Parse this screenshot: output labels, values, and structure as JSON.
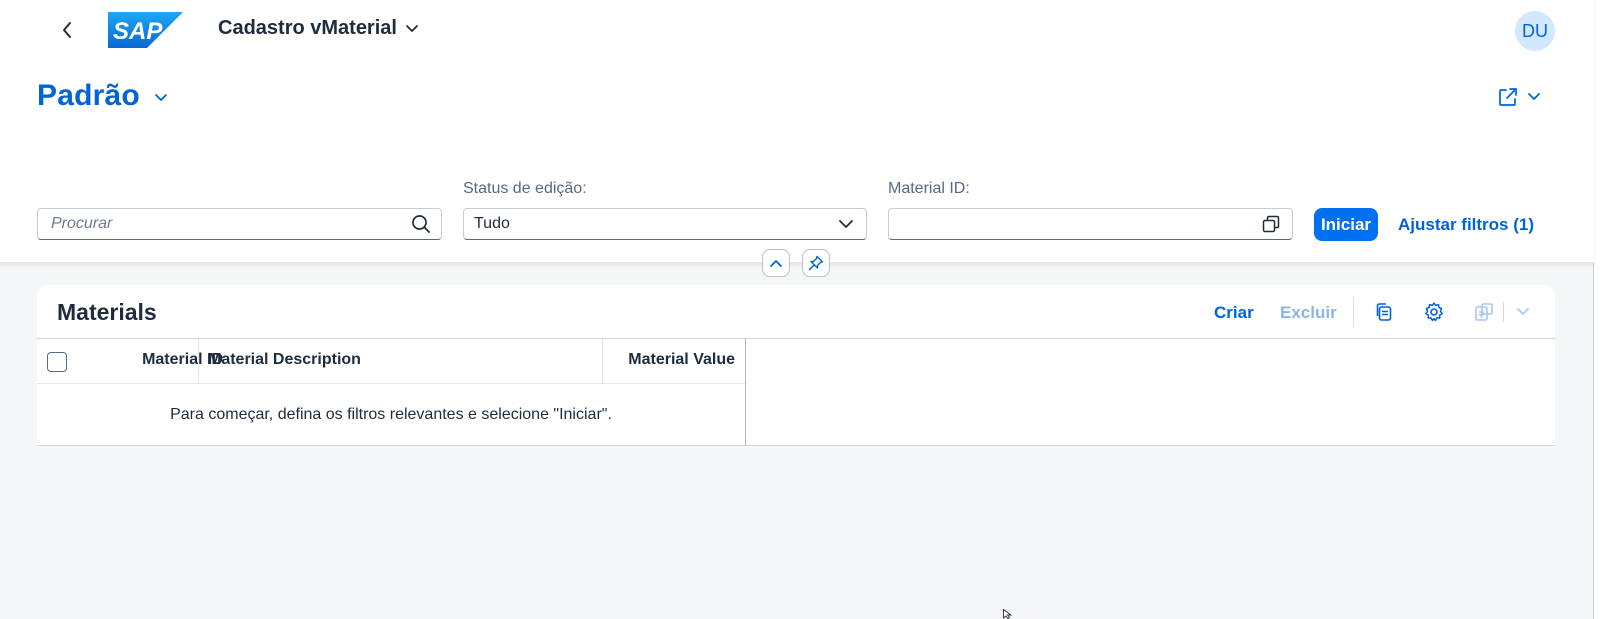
{
  "shell": {
    "app_title": "Cadastro vMaterial",
    "user_initials": "DU",
    "logo_text": "SAP"
  },
  "header": {
    "variant_title": "Padrão"
  },
  "filters": {
    "search_placeholder": "Procurar",
    "status_label": "Status de edição:",
    "status_value": "Tudo",
    "material_id_label": "Material ID:",
    "material_id_value": "",
    "go_button": "Iniciar",
    "adapt_filters": "Ajustar filtros (1)"
  },
  "table": {
    "title": "Materials",
    "toolbar": {
      "create": "Criar",
      "delete": "Excluir"
    },
    "columns": [
      "Material ID",
      "Material Description",
      "Material Value"
    ],
    "empty_text": "Para começar, defina os filtros relevantes e selecione \"Iniciar\"."
  },
  "colors": {
    "brand_blue": "#0064d9",
    "button_blue": "#0070f2",
    "disabled_blue": "#8cb4e6",
    "background": "#f5f6f7"
  }
}
